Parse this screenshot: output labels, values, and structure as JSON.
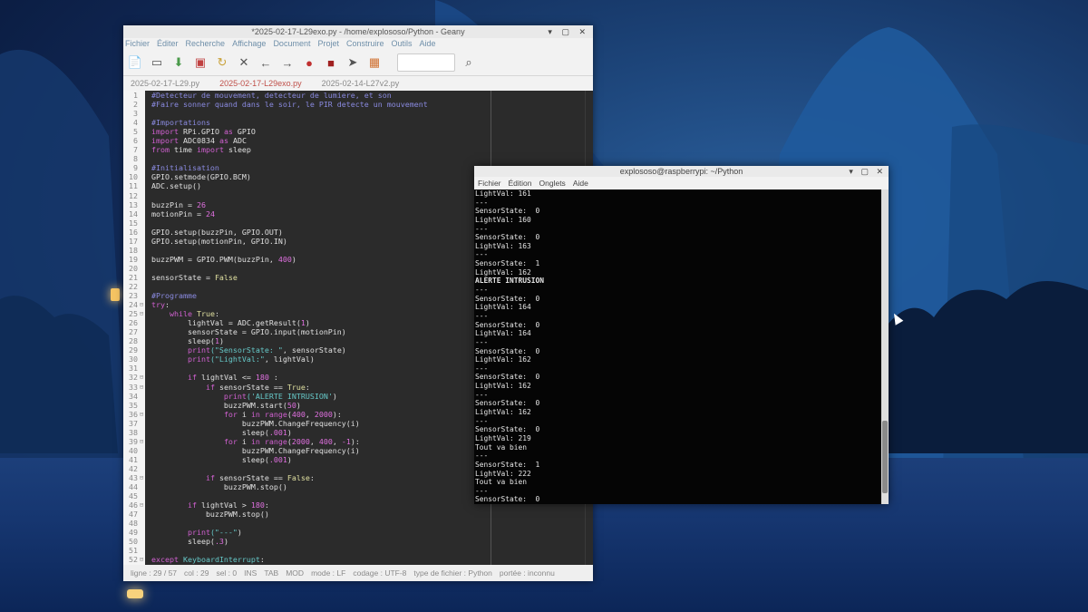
{
  "geany": {
    "title": "*2025-02-17-L29exo.py - /home/explososo/Python - Geany",
    "menu": [
      "Fichier",
      "Éditer",
      "Recherche",
      "Affichage",
      "Document",
      "Projet",
      "Construire",
      "Outils",
      "Aide"
    ],
    "toolbar_icons": [
      "new-file-icon",
      "open-file-icon",
      "save-icon",
      "save-all-icon",
      "revert-icon",
      "close-icon",
      "back-arrow-icon",
      "forward-arrow-icon",
      "compile-icon",
      "build-icon",
      "run-icon",
      "color-chooser-icon",
      "search-box",
      "jump-icon"
    ],
    "tabs": [
      {
        "label": "2025-02-17-L29.py",
        "active": false
      },
      {
        "label": "2025-02-17-L29exo.py",
        "active": true
      },
      {
        "label": "2025-02-14-L27v2.py",
        "active": false
      }
    ],
    "code_lines": [
      {
        "n": "1",
        "fold": "",
        "segs": [
          [
            "c",
            "#Detecteur de mouvement, detecteur de lumiere, et son"
          ]
        ]
      },
      {
        "n": "2",
        "fold": "",
        "segs": [
          [
            "c",
            "#Faire sonner quand dans le soir, le PIR detecte un mouvement"
          ]
        ]
      },
      {
        "n": "3",
        "fold": "",
        "segs": []
      },
      {
        "n": "4",
        "fold": "",
        "segs": [
          [
            "c",
            "#Importations"
          ]
        ]
      },
      {
        "n": "5",
        "fold": "",
        "segs": [
          [
            "k",
            "import"
          ],
          [
            "f",
            " RPi.GPIO "
          ],
          [
            "k",
            "as"
          ],
          [
            "f",
            " GPIO"
          ]
        ]
      },
      {
        "n": "6",
        "fold": "",
        "segs": [
          [
            "k",
            "import"
          ],
          [
            "f",
            " ADC0834 "
          ],
          [
            "k",
            "as"
          ],
          [
            "f",
            " ADC"
          ]
        ]
      },
      {
        "n": "7",
        "fold": "",
        "segs": [
          [
            "k",
            "from"
          ],
          [
            "f",
            " time "
          ],
          [
            "k",
            "import"
          ],
          [
            "f",
            " sleep"
          ]
        ]
      },
      {
        "n": "8",
        "fold": "",
        "segs": []
      },
      {
        "n": "9",
        "fold": "",
        "segs": [
          [
            "c",
            "#Initialisation"
          ]
        ]
      },
      {
        "n": "10",
        "fold": "",
        "segs": [
          [
            "f",
            "GPIO.setmode(GPIO.BCM)"
          ]
        ]
      },
      {
        "n": "11",
        "fold": "",
        "segs": [
          [
            "f",
            "ADC.setup()"
          ]
        ]
      },
      {
        "n": "12",
        "fold": "",
        "segs": []
      },
      {
        "n": "13",
        "fold": "",
        "segs": [
          [
            "f",
            "buzzPin = "
          ],
          [
            "n",
            "26"
          ]
        ]
      },
      {
        "n": "14",
        "fold": "",
        "segs": [
          [
            "f",
            "motionPin = "
          ],
          [
            "n",
            "24"
          ]
        ]
      },
      {
        "n": "15",
        "fold": "",
        "segs": []
      },
      {
        "n": "16",
        "fold": "",
        "segs": [
          [
            "f",
            "GPIO.setup(buzzPin, GPIO.OUT)"
          ]
        ]
      },
      {
        "n": "17",
        "fold": "",
        "segs": [
          [
            "f",
            "GPIO.setup(motionPin, GPIO.IN)"
          ]
        ]
      },
      {
        "n": "18",
        "fold": "",
        "segs": []
      },
      {
        "n": "19",
        "fold": "",
        "segs": [
          [
            "f",
            "buzzPWM = GPIO.PWM(buzzPin, "
          ],
          [
            "n",
            "400"
          ],
          [
            "f",
            ")"
          ]
        ]
      },
      {
        "n": "20",
        "fold": "",
        "segs": []
      },
      {
        "n": "21",
        "fold": "",
        "segs": [
          [
            "f",
            "sensorState = "
          ],
          [
            "b",
            "False"
          ]
        ]
      },
      {
        "n": "22",
        "fold": "",
        "segs": []
      },
      {
        "n": "23",
        "fold": "",
        "segs": [
          [
            "c",
            "#Programme"
          ]
        ]
      },
      {
        "n": "24",
        "fold": "⊟",
        "segs": [
          [
            "k",
            "try"
          ],
          [
            "f",
            ":"
          ]
        ]
      },
      {
        "n": "25",
        "fold": "⊟",
        "segs": [
          [
            "f",
            "    "
          ],
          [
            "k",
            "while"
          ],
          [
            "b",
            " True"
          ],
          [
            "f",
            ":"
          ]
        ]
      },
      {
        "n": "26",
        "fold": "",
        "segs": [
          [
            "f",
            "        lightVal = ADC.getResult("
          ],
          [
            "n",
            "1"
          ],
          [
            "f",
            ")"
          ]
        ]
      },
      {
        "n": "27",
        "fold": "",
        "segs": [
          [
            "f",
            "        sensorState = GPIO.input(motionPin)"
          ]
        ]
      },
      {
        "n": "28",
        "fold": "",
        "segs": [
          [
            "f",
            "        sleep("
          ],
          [
            "n",
            "1"
          ],
          [
            "f",
            ")"
          ]
        ]
      },
      {
        "n": "29",
        "fold": "",
        "segs": [
          [
            "k",
            "        print"
          ],
          [
            "s",
            "(\"SensorState: \""
          ],
          [
            "f",
            ", sensorState)"
          ]
        ]
      },
      {
        "n": "30",
        "fold": "",
        "segs": [
          [
            "k",
            "        print"
          ],
          [
            "s",
            "(\"LightVal:\""
          ],
          [
            "f",
            ", lightVal)"
          ]
        ]
      },
      {
        "n": "31",
        "fold": "",
        "segs": []
      },
      {
        "n": "32",
        "fold": "⊟",
        "segs": [
          [
            "f",
            "        "
          ],
          [
            "k",
            "if"
          ],
          [
            "f",
            " lightVal <= "
          ],
          [
            "n",
            "180"
          ],
          [
            "f",
            " :"
          ]
        ]
      },
      {
        "n": "33",
        "fold": "⊟",
        "segs": [
          [
            "f",
            "            "
          ],
          [
            "k",
            "if"
          ],
          [
            "f",
            " sensorState == "
          ],
          [
            "b",
            "True"
          ],
          [
            "f",
            ":"
          ]
        ]
      },
      {
        "n": "34",
        "fold": "",
        "segs": [
          [
            "k",
            "                print"
          ],
          [
            "s",
            "('ALERTE INTRUSION'"
          ],
          [
            "f",
            ")"
          ]
        ]
      },
      {
        "n": "35",
        "fold": "",
        "segs": [
          [
            "f",
            "                buzzPWM.start("
          ],
          [
            "n",
            "50"
          ],
          [
            "f",
            ")"
          ]
        ]
      },
      {
        "n": "36",
        "fold": "⊟",
        "segs": [
          [
            "f",
            "                "
          ],
          [
            "k",
            "for"
          ],
          [
            "f",
            " i "
          ],
          [
            "k",
            "in"
          ],
          [
            "k",
            " range"
          ],
          [
            "f",
            "("
          ],
          [
            "n",
            "400"
          ],
          [
            "f",
            ", "
          ],
          [
            "n",
            "2000"
          ],
          [
            "f",
            "):"
          ]
        ]
      },
      {
        "n": "37",
        "fold": "",
        "segs": [
          [
            "f",
            "                    buzzPWM.ChangeFrequency(i)"
          ]
        ]
      },
      {
        "n": "38",
        "fold": "",
        "segs": [
          [
            "f",
            "                    sleep("
          ],
          [
            "n",
            ".001"
          ],
          [
            "f",
            ")"
          ]
        ]
      },
      {
        "n": "39",
        "fold": "⊟",
        "segs": [
          [
            "f",
            "                "
          ],
          [
            "k",
            "for"
          ],
          [
            "f",
            " i "
          ],
          [
            "k",
            "in"
          ],
          [
            "k",
            " range"
          ],
          [
            "f",
            "("
          ],
          [
            "n",
            "2000"
          ],
          [
            "f",
            ", "
          ],
          [
            "n",
            "400"
          ],
          [
            "f",
            ", "
          ],
          [
            "n",
            "-1"
          ],
          [
            "f",
            "):"
          ]
        ]
      },
      {
        "n": "40",
        "fold": "",
        "segs": [
          [
            "f",
            "                    buzzPWM.ChangeFrequency(i)"
          ]
        ]
      },
      {
        "n": "41",
        "fold": "",
        "segs": [
          [
            "f",
            "                    sleep("
          ],
          [
            "n",
            ".001"
          ],
          [
            "f",
            ")"
          ]
        ]
      },
      {
        "n": "42",
        "fold": "",
        "segs": []
      },
      {
        "n": "43",
        "fold": "⊟",
        "segs": [
          [
            "f",
            "            "
          ],
          [
            "k",
            "if"
          ],
          [
            "f",
            " sensorState == "
          ],
          [
            "b",
            "False"
          ],
          [
            "f",
            ":"
          ]
        ]
      },
      {
        "n": "44",
        "fold": "",
        "segs": [
          [
            "f",
            "                buzzPWM.stop()"
          ]
        ]
      },
      {
        "n": "45",
        "fold": "",
        "segs": []
      },
      {
        "n": "46",
        "fold": "⊟",
        "segs": [
          [
            "f",
            "        "
          ],
          [
            "k",
            "if"
          ],
          [
            "f",
            " lightVal > "
          ],
          [
            "n",
            "180"
          ],
          [
            "f",
            ":"
          ]
        ]
      },
      {
        "n": "47",
        "fold": "",
        "segs": [
          [
            "f",
            "            buzzPWM.stop()"
          ]
        ]
      },
      {
        "n": "48",
        "fold": "",
        "segs": []
      },
      {
        "n": "49",
        "fold": "",
        "segs": [
          [
            "k",
            "        print"
          ],
          [
            "s",
            "(\"---\""
          ],
          [
            "f",
            ")"
          ]
        ]
      },
      {
        "n": "50",
        "fold": "",
        "segs": [
          [
            "f",
            "        sleep("
          ],
          [
            "n",
            ".3"
          ],
          [
            "f",
            ")"
          ]
        ]
      },
      {
        "n": "51",
        "fold": "",
        "segs": []
      },
      {
        "n": "52",
        "fold": "⊟",
        "segs": [
          [
            "k",
            "except"
          ],
          [
            "s",
            " KeyboardInterrupt"
          ],
          [
            "f",
            ":"
          ]
        ]
      }
    ],
    "status": [
      "ligne : 29 / 57",
      "col : 29",
      "sel : 0",
      "INS",
      "TAB",
      "MOD",
      "mode : LF",
      "codage : UTF-8",
      "type de fichier : Python",
      "portée : inconnu"
    ]
  },
  "terminal": {
    "title": "explososo@raspberrypi: ~/Python",
    "menu": [
      "Fichier",
      "Édition",
      "Onglets",
      "Aide"
    ],
    "lines": [
      "LightVal: 161",
      "---",
      "SensorState:  0",
      "LightVal: 160",
      "---",
      "SensorState:  0",
      "LightVal: 163",
      "---",
      "SensorState:  1",
      "LightVal: 162",
      "ALERTE INTRUSION",
      "---",
      "SensorState:  0",
      "LightVal: 164",
      "---",
      "SensorState:  0",
      "LightVal: 164",
      "---",
      "SensorState:  0",
      "LightVal: 162",
      "---",
      "SensorState:  0",
      "LightVal: 162",
      "---",
      "SensorState:  0",
      "LightVal: 162",
      "---",
      "SensorState:  0",
      "LightVal: 219",
      "Tout va bien",
      "---",
      "SensorState:  1",
      "LightVal: 222",
      "Tout va bien",
      "---",
      "SensorState:  0"
    ],
    "bold_line": "ALERTE INTRUSION"
  }
}
